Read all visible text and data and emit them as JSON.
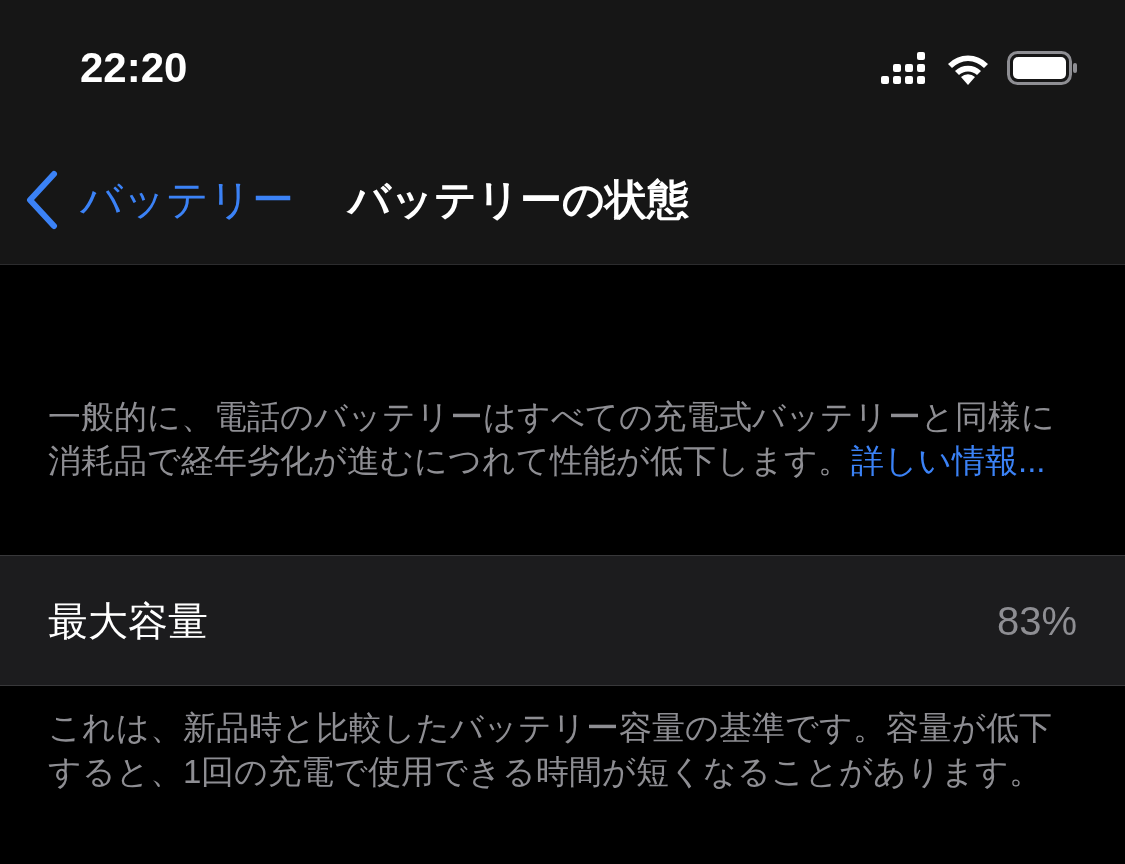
{
  "status_bar": {
    "time": "22:20"
  },
  "nav": {
    "back_label": "バッテリー",
    "title": "バッテリーの状態"
  },
  "intro": {
    "text": "一般的に、電話のバッテリーはすべての充電式バッテリーと同様に消耗品で経年劣化が進むにつれて性能が低下します。",
    "link": "詳しい情報..."
  },
  "row": {
    "label": "最大容量",
    "value": "83%"
  },
  "footer": "これは、新品時と比較したバッテリー容量の基準です。容量が低下すると、1回の充電で使用できる時間が短くなることがあります。"
}
